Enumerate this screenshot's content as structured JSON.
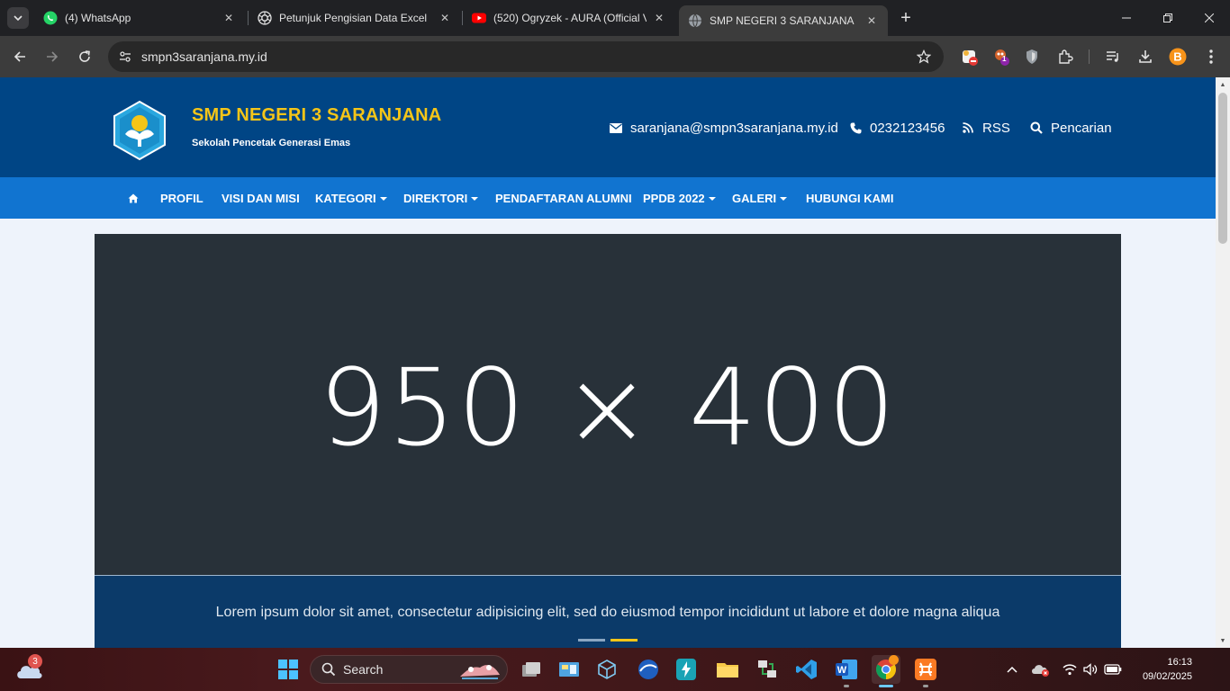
{
  "browser": {
    "tabs": [
      {
        "title": "(4) WhatsApp",
        "icon": "whatsapp-icon"
      },
      {
        "title": "Petunjuk Pengisian Data Excel",
        "icon": "openai-icon"
      },
      {
        "title": "(520) Ogryzek - AURA (Official V",
        "icon": "youtube-icon"
      },
      {
        "title": "SMP NEGERI 3 SARANJANA",
        "icon": "globe-icon",
        "active": true
      }
    ],
    "url": "smpn3saranjana.my.id",
    "extension_badge": "1"
  },
  "site": {
    "title": "SMP NEGERI 3 SARANJANA",
    "tagline": "Sekolah Pencetak Generasi Emas",
    "email": "saranjana@smpn3saranjana.my.id",
    "phone": "0232123456",
    "rss": "RSS",
    "search": "Pencarian",
    "nav": [
      "PROFIL",
      "VISI DAN MISI",
      "KATEGORI",
      "DIREKTORI",
      "PENDAFTARAN ALUMNI",
      "PPDB 2022",
      "GALERI",
      "HUBUNGI KAMI"
    ],
    "slider": {
      "placeholder": "950 × 400",
      "caption": "Lorem ipsum dolor sit amet, consectetur adipisicing elit, sed do eiusmod tempor incididunt ut labore et dolore magna aliqua",
      "active_slide": 2,
      "slide_count": 2
    }
  },
  "colors": {
    "header": "#004585",
    "navbar": "#1174d0",
    "title": "#f5c518",
    "caption_bg": "#0b3a69"
  },
  "taskbar": {
    "weather_badge": "3",
    "search_label": "Search",
    "time": "16:13",
    "date": "09/02/2025"
  }
}
